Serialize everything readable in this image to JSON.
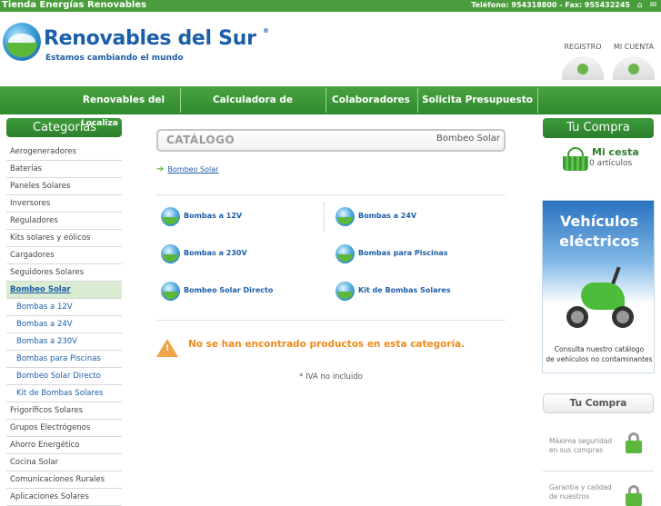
{
  "topbar": {
    "shop_name": "Tienda Energías Renovables",
    "contact": "Teléfono: 954318800 - Fax: 955432245",
    "icons": [
      "home-icon",
      "mail-icon"
    ]
  },
  "header": {
    "logo_name": "Renovables del Sur",
    "logo_symbol": "®",
    "logo_tagline": "Estamos cambiando el mundo",
    "register_label": "REGISTRO",
    "account_label": "MI CUENTA"
  },
  "nav": {
    "items": [
      "Renovables del Sur",
      "Calculadora de consumos",
      "Colaboradores",
      "Solicita Presupuesto"
    ]
  },
  "sidebar": {
    "title": "Categorias",
    "overlay_text": "Localiza",
    "items": [
      {
        "label": "Aerogeneradores"
      },
      {
        "label": "Baterías"
      },
      {
        "label": "Paneles Solares"
      },
      {
        "label": "Inversores"
      },
      {
        "label": "Reguladores"
      },
      {
        "label": "Kits solares y eólicos"
      },
      {
        "label": "Cargadores"
      },
      {
        "label": "Seguidores Solares"
      },
      {
        "label": "Bombeo Solar",
        "active": true
      },
      {
        "label": "Bombas a 12V",
        "sub": true
      },
      {
        "label": "Bombas a 24V",
        "sub": true
      },
      {
        "label": "Bombas a 230V",
        "sub": true
      },
      {
        "label": "Bombas para Piscinas",
        "sub": true
      },
      {
        "label": "Bombeo Solar Directo",
        "sub": true
      },
      {
        "label": "Kit de Bombas Solares",
        "sub": true
      },
      {
        "label": "Frigoríficos Solares"
      },
      {
        "label": "Grupos Electrógenos"
      },
      {
        "label": "Ahorro Energético"
      },
      {
        "label": "Cocina Solar"
      },
      {
        "label": "Comunicaciones Rurales"
      },
      {
        "label": "Aplicaciones Solares"
      }
    ]
  },
  "main": {
    "catalog_title": "CATÁLOGO",
    "current_category": "Bombeo Solar",
    "breadcrumb": "Bombeo Solar",
    "subcategories": [
      "Bombas a 12V",
      "Bombas a 24V",
      "Bombas a 230V",
      "Bombas para Piscinas",
      "Bombeo Solar Directo",
      "Kit de Bombas Solares"
    ],
    "notice": "No se han encontrado productos en esta categoría.",
    "warning_glyph": "!",
    "iva_note": "* IVA no incluido"
  },
  "right": {
    "cart_title": "Tu Compra",
    "basket_title": "Mi cesta",
    "basket_count": "0 artículos",
    "banner_title_1": "Vehículos",
    "banner_title_2": "eléctricos",
    "banner_text_1": "Consulta nuestro catálogo",
    "banner_text_2": "de vehículos no contaminantes",
    "box2_title": "Tu Compra",
    "feature_1a": "Máxima seguridad",
    "feature_1b": "en sus compras",
    "feature_2a": "Garantía y calidad",
    "feature_2b": "de nuestros"
  }
}
